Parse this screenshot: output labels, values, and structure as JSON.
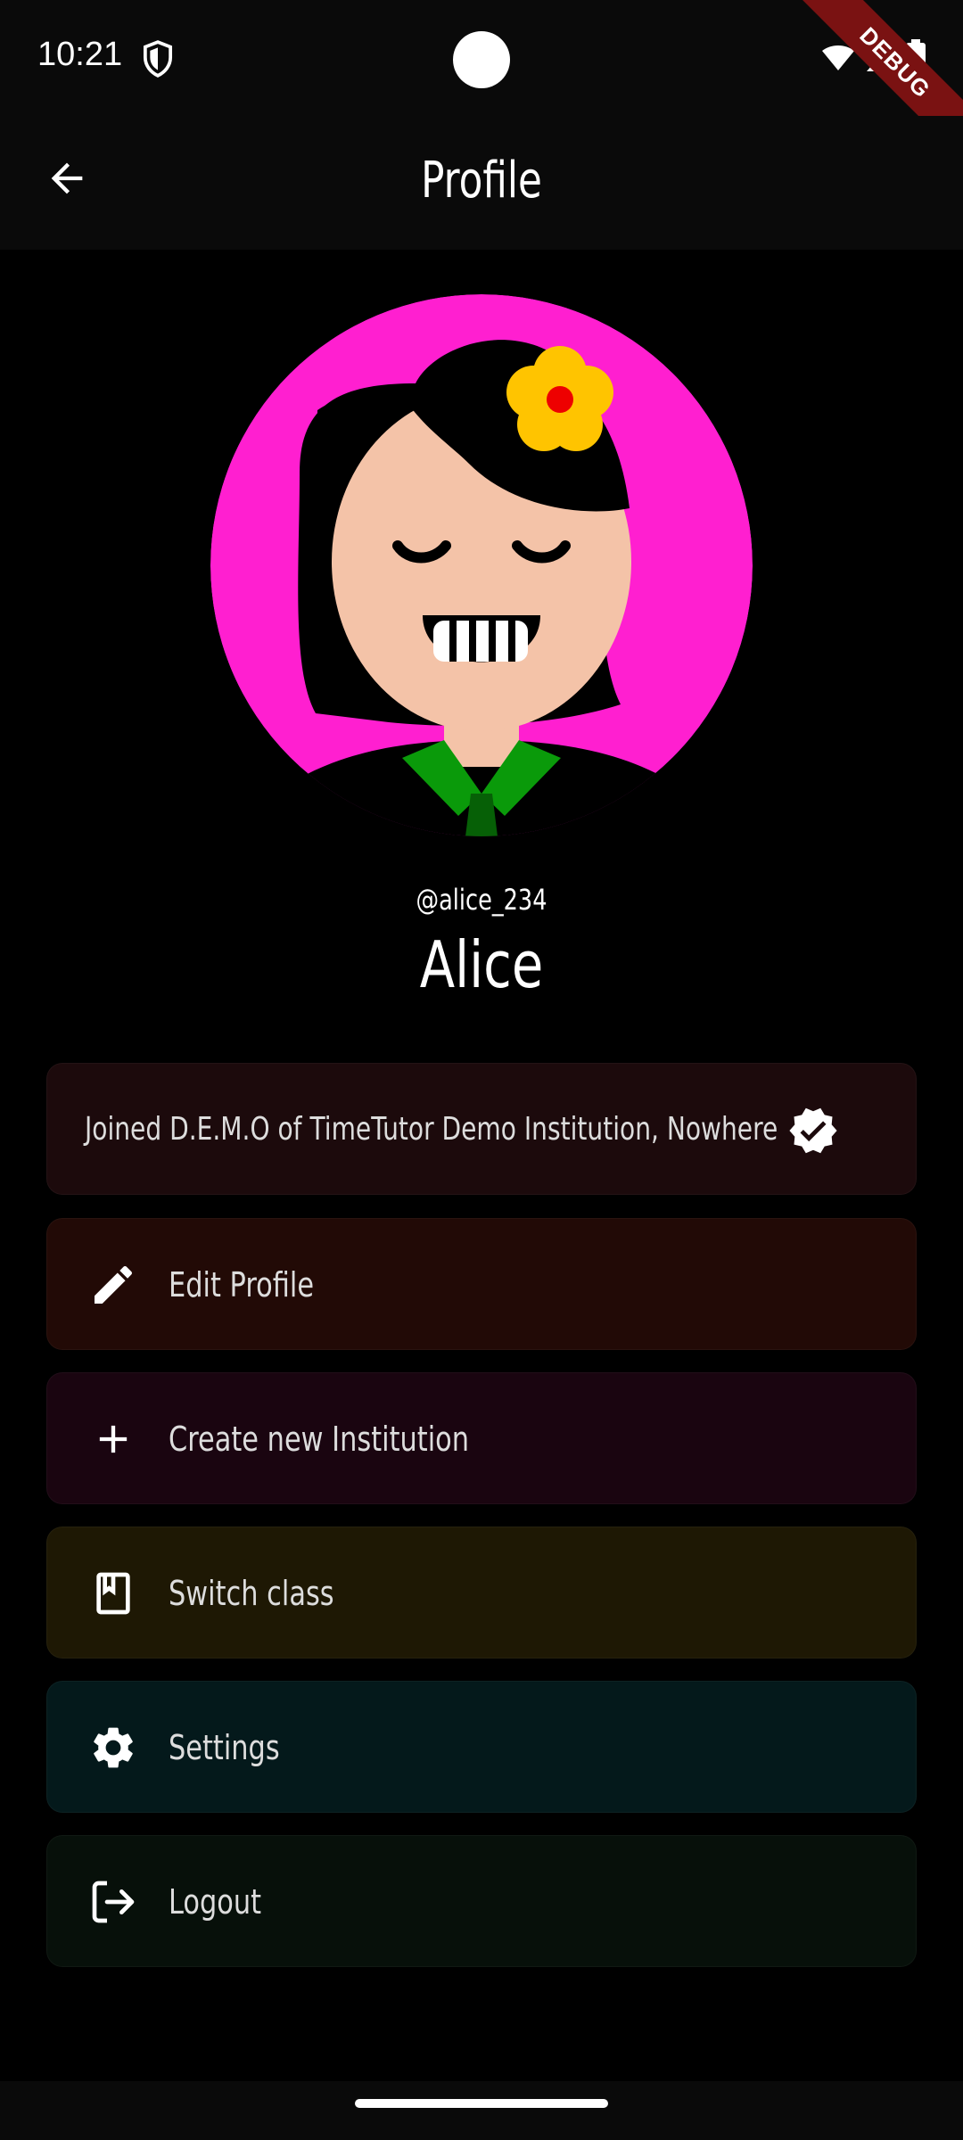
{
  "status_bar": {
    "time": "10:21",
    "debug_label": "DEBUG"
  },
  "app_bar": {
    "title": "Profile"
  },
  "profile": {
    "handle": "@alice_234",
    "name": "Alice"
  },
  "joined": {
    "text": "Joined D.E.M.O of TimeTutor Demo Institution, Nowhere",
    "icon": "verified-icon"
  },
  "menu": {
    "edit_profile": {
      "label": "Edit Profile",
      "icon": "pencil-icon"
    },
    "create_institution": {
      "label": "Create new Institution",
      "icon": "plus-icon"
    },
    "switch_class": {
      "label": "Switch class",
      "icon": "book-icon"
    },
    "settings": {
      "label": "Settings",
      "icon": "gear-icon"
    },
    "logout": {
      "label": "Logout",
      "icon": "logout-icon"
    }
  },
  "colors": {
    "avatar_bg": "#ff1fd0",
    "joined_bg": "#1c0a0c",
    "edit_bg": "#220a06",
    "create_bg": "#1a0510",
    "switch_bg": "#1e1804",
    "settings_bg": "#04191b",
    "logout_bg": "#07100a"
  }
}
